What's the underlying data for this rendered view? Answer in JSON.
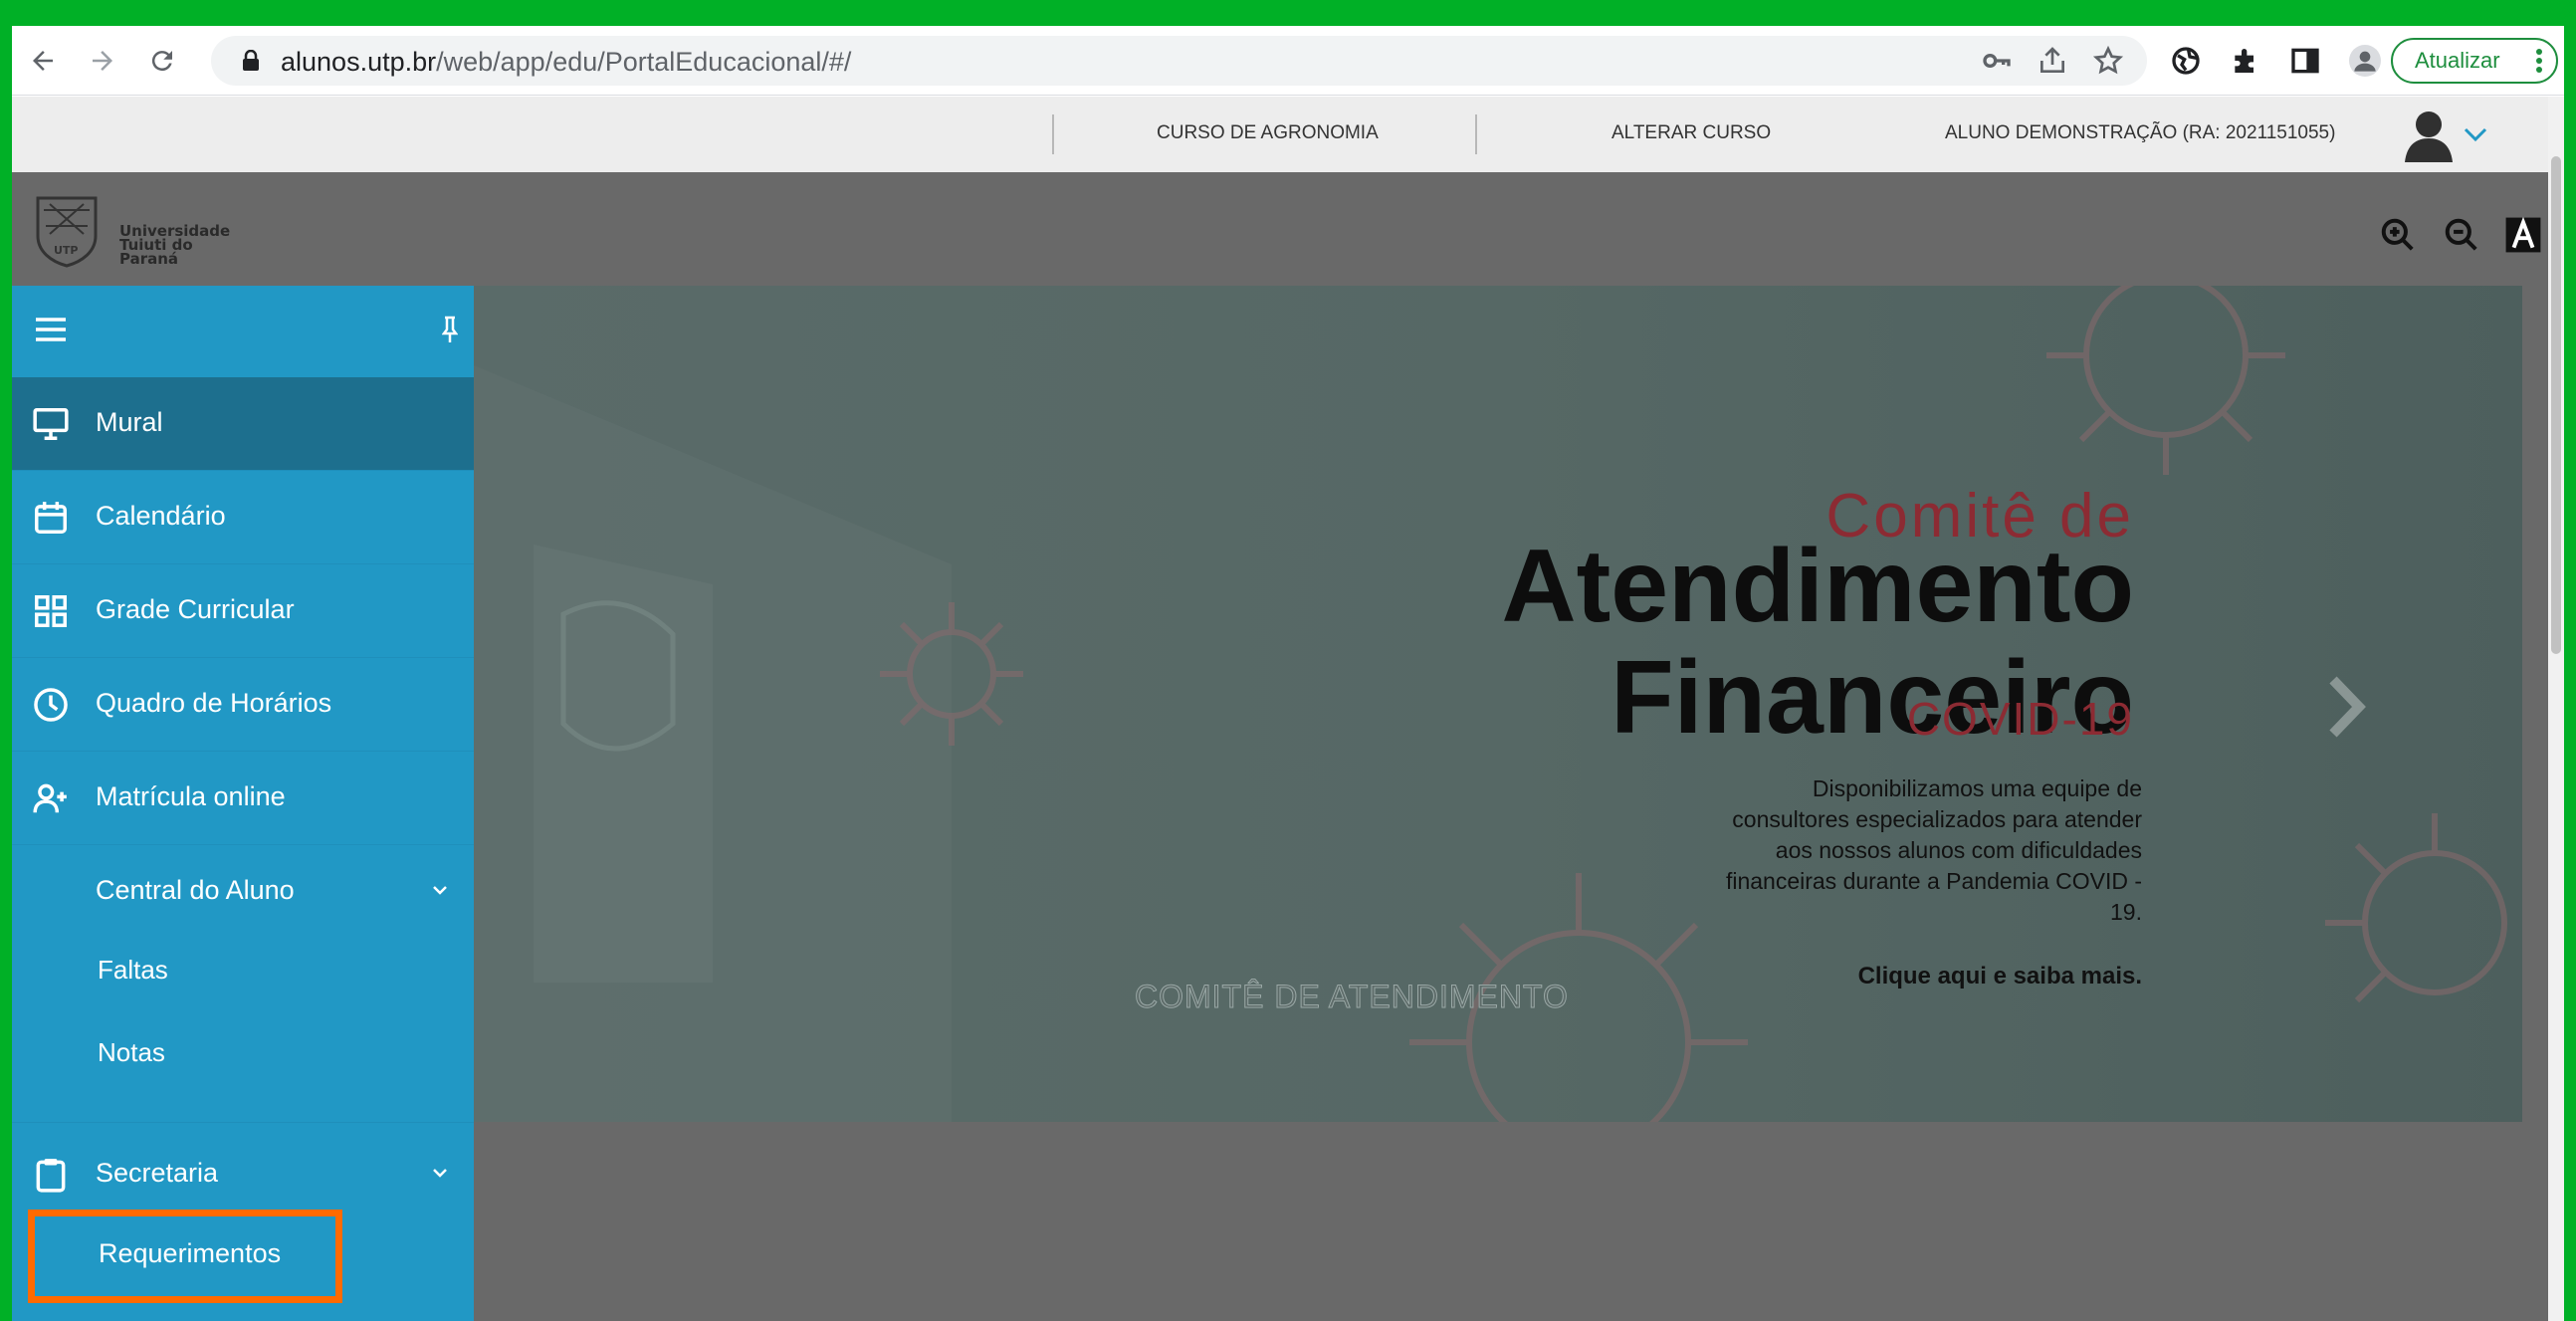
{
  "browser": {
    "url_host": "alunos.utp.br",
    "url_path": "/web/app/edu/PortalEducacional/#/",
    "update_label": "Atualizar"
  },
  "topbar": {
    "course": "CURSO DE AGRONOMIA",
    "change_course": "ALTERAR CURSO",
    "student": "ALUNO DEMONSTRAÇÃO (RA: 2021151055)"
  },
  "logo": {
    "line1": "Universidade",
    "line2": "Tuiuti do",
    "line3": "Paraná"
  },
  "sidebar": {
    "items": [
      {
        "label": "Mural",
        "icon": "monitor-icon"
      },
      {
        "label": "Calendário",
        "icon": "calendar-icon"
      },
      {
        "label": "Grade Curricular",
        "icon": "grid-icon"
      },
      {
        "label": "Quadro de Horários",
        "icon": "clock-icon"
      },
      {
        "label": "Matrícula online",
        "icon": "user-plus-icon"
      },
      {
        "label": "Central do Aluno",
        "icon": ""
      }
    ],
    "central_sub": [
      "Faltas",
      "Notas"
    ],
    "secretaria": "Secretaria",
    "secretaria_sub": [
      "Requerimentos"
    ]
  },
  "banner": {
    "title1": "Comitê de",
    "title2": "Atendimento",
    "title3": "Financeiro",
    "covid": "COVID-19",
    "text": "Disponibilizamos uma equipe de consultores especializados para atender aos nossos alunos com dificuldades financeiras durante a Pandemia COVID - 19.",
    "cta": "Clique aqui e saiba mais.",
    "caption": "COMITÊ DE ATENDIMENTO"
  },
  "colors": {
    "frame": "#00b026",
    "sidebar": "#2198c5",
    "sidebar_active": "#1d6f8e",
    "highlight": "#ff6a00"
  }
}
